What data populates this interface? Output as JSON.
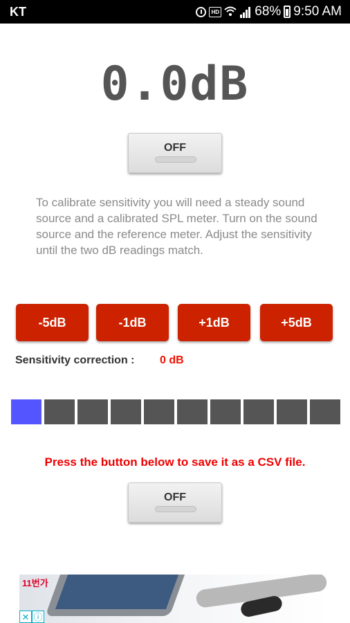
{
  "status_bar": {
    "carrier": "KT",
    "battery": "68%",
    "time": "9:50 AM",
    "icons": [
      "alarm-icon",
      "hd-icon",
      "wifi-icon",
      "signal-icon",
      "battery-icon"
    ]
  },
  "readout": {
    "value": "0.0dB"
  },
  "top_toggle": {
    "label": "OFF"
  },
  "instructions": "To calibrate sensitivity you will need a steady sound source and a calibrated SPL meter. Turn on the sound source and the reference meter. Adjust the sensitivity until the two dB readings match.",
  "adjust_buttons": [
    {
      "label": "-5dB"
    },
    {
      "label": "-1dB"
    },
    {
      "label": "+1dB"
    },
    {
      "label": "+5dB"
    }
  ],
  "sensitivity": {
    "label": "Sensitivity correction :",
    "value": "0 dB"
  },
  "level_meter": {
    "segments": 10,
    "active_segments": 1,
    "active_color": "#5555ff",
    "inactive_color": "#555555"
  },
  "csv_note": "Press the button below to save it as a CSV file.",
  "bottom_toggle": {
    "label": "OFF"
  },
  "ad": {
    "brand": "11번가",
    "controls": [
      "close-icon",
      "info-icon"
    ]
  },
  "colors": {
    "accent_red": "#cc2200",
    "alert_red": "#ee0000"
  }
}
